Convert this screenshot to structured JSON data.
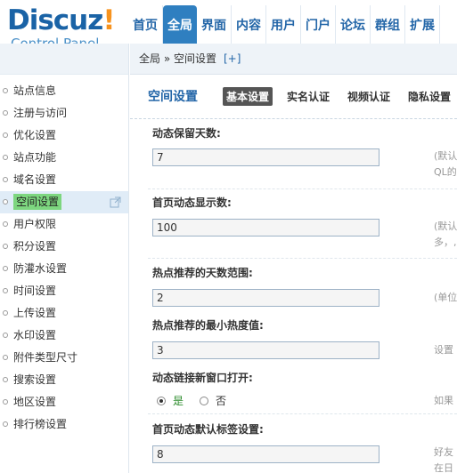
{
  "logo": {
    "brand": "Discuz",
    "bang": "!",
    "subtitle": "Control Panel"
  },
  "topnav": [
    "首页",
    "全局",
    "界面",
    "内容",
    "用户",
    "门户",
    "论坛",
    "群组",
    "扩展"
  ],
  "breadcrumb": {
    "path": "全局 » 空间设置",
    "plus": "[+]"
  },
  "sidebar": {
    "items": [
      "站点信息",
      "注册与访问",
      "优化设置",
      "站点功能",
      "域名设置",
      "空间设置",
      "用户权限",
      "积分设置",
      "防灌水设置",
      "时间设置",
      "上传设置",
      "水印设置",
      "附件类型尺寸",
      "搜索设置",
      "地区设置",
      "排行榜设置"
    ]
  },
  "subnav": {
    "title": "空间设置",
    "tabs": [
      "基本设置",
      "实名认证",
      "视频认证",
      "隐私设置"
    ]
  },
  "settings": {
    "feed_days": {
      "label": "动态保留天数:",
      "value": "7",
      "hint1": "(默认",
      "hint2": "QL的"
    },
    "home_feed_count": {
      "label": "首页动态显示数:",
      "value": "100",
      "hint1": "(默认",
      "hint2": "多，,"
    },
    "hot_days": {
      "label": "热点推荐的天数范围:",
      "value": "2",
      "hint1": "(单位"
    },
    "hot_min": {
      "label": "热点推荐的最小热度值:",
      "value": "3",
      "hint1": "设置"
    },
    "link_newwin": {
      "label": "动态链接新窗口打开:",
      "yes": "是",
      "no": "否",
      "hint1": "如果"
    },
    "default_tab": {
      "label": "首页动态默认标签设置:",
      "value": "8",
      "hint1": "好友",
      "hint2": "在日"
    }
  },
  "colors": {
    "brand": "#1a63a6",
    "accent": "#f7931e",
    "active_nav": "#2f7fc0",
    "active_menu": "#7dd67f"
  }
}
